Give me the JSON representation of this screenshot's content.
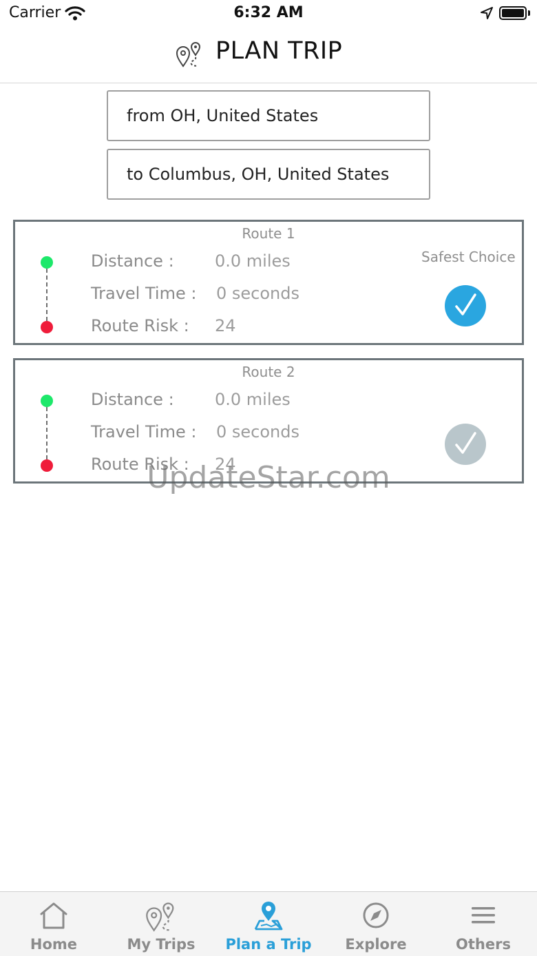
{
  "status_bar": {
    "carrier": "Carrier",
    "time": "6:32 AM"
  },
  "header": {
    "title": "PLAN TRIP",
    "icon": "route-pins-icon"
  },
  "trip": {
    "from_value": "from OH, United States",
    "to_value": "to Columbus, OH, United States"
  },
  "routes": [
    {
      "title": "Route 1",
      "distance_label": "Distance :",
      "distance_value": "0.0 miles",
      "time_label": "Travel Time :",
      "time_value": "0 seconds",
      "risk_label": "Route Risk :",
      "risk_value": "24",
      "badge": "Safest Choice",
      "selected": true
    },
    {
      "title": "Route 2",
      "distance_label": "Distance :",
      "distance_value": "0.0 miles",
      "time_label": "Travel Time :",
      "time_value": "0 seconds",
      "risk_label": "Route Risk :",
      "risk_value": "24",
      "selected": false
    }
  ],
  "watermark": "UpdateStar.com",
  "tabs": [
    {
      "label": "Home",
      "icon": "home-icon"
    },
    {
      "label": "My Trips",
      "icon": "route-pins-icon"
    },
    {
      "label": "Plan a Trip",
      "icon": "map-pin-icon",
      "active": true
    },
    {
      "label": "Explore",
      "icon": "compass-icon"
    },
    {
      "label": "Others",
      "icon": "menu-icon"
    }
  ],
  "colors": {
    "accent": "#2aa6e0",
    "start_dot": "#1de86a",
    "end_dot": "#ef1c3a",
    "card_border": "#6c757a",
    "check_inactive": "#b9c6cb"
  }
}
